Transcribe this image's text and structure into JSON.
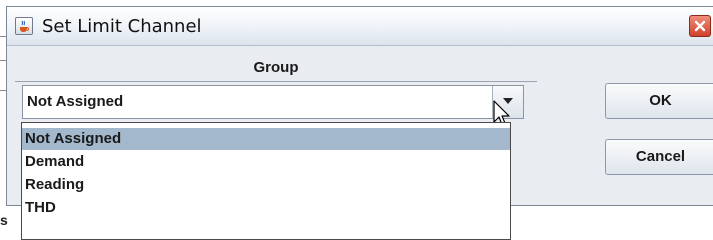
{
  "dialog": {
    "title": "Set Limit Channel",
    "icons": {
      "app": "java-cup-icon",
      "close": "close-x-icon"
    }
  },
  "group": {
    "header": "Group",
    "selected_value": "Not Assigned",
    "options": [
      "Not Assigned",
      "Demand",
      "Reading",
      "THD"
    ]
  },
  "buttons": {
    "ok": "OK",
    "cancel": "Cancel"
  },
  "background": {
    "label_fragment": "s"
  },
  "colors": {
    "selection": "#a3b8cc",
    "close_button": "#d0402b"
  }
}
